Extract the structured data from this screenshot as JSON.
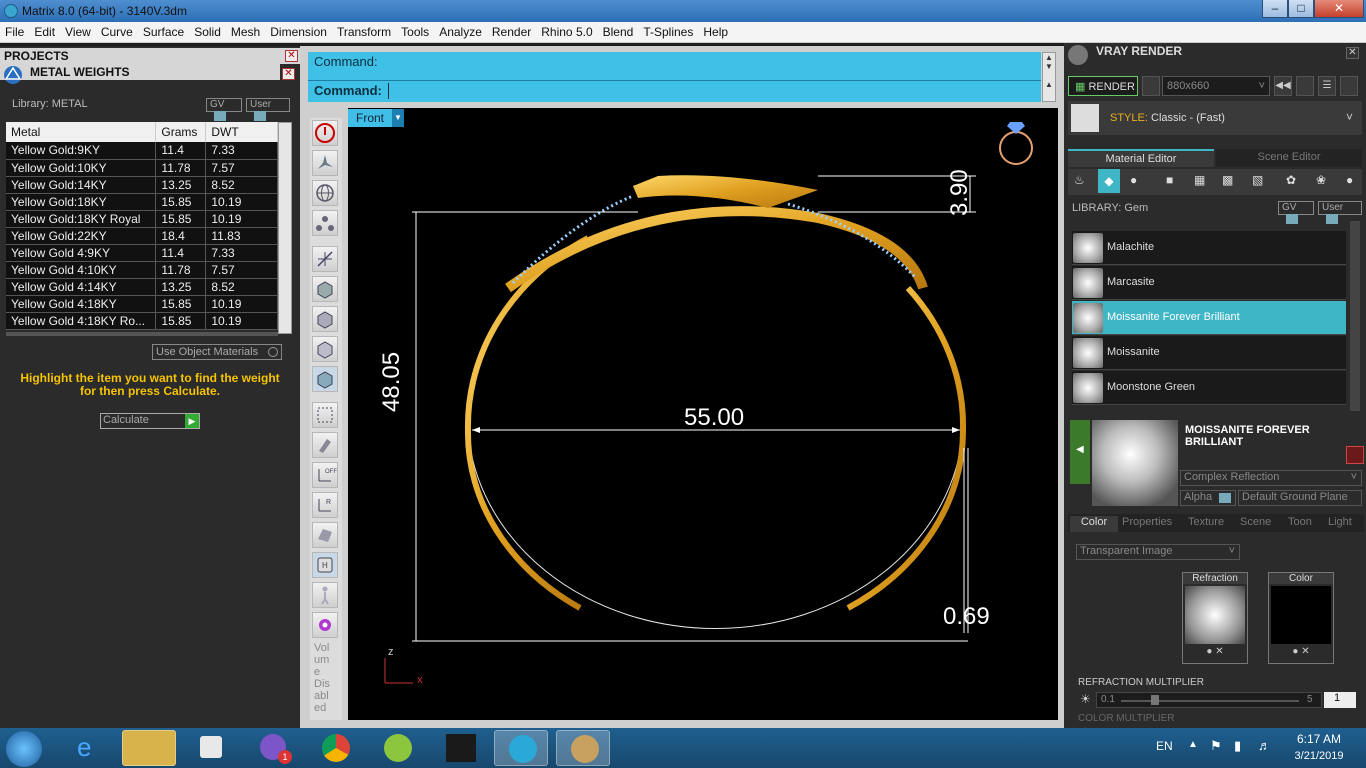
{
  "window": {
    "title": "Matrix 8.0 (64-bit) - 3140V.3dm"
  },
  "menu": [
    "File",
    "Edit",
    "View",
    "Curve",
    "Surface",
    "Solid",
    "Mesh",
    "Dimension",
    "Transform",
    "Tools",
    "Analyze",
    "Render",
    "Rhino 5.0",
    "Blend",
    "T-Splines",
    "Help"
  ],
  "left": {
    "projects_title": "PROJECTS",
    "panel_title": "METAL WEIGHTS",
    "library": "Library: METAL",
    "gv": "GV",
    "user": "User",
    "columns": [
      "Metal",
      "Grams",
      "DWT"
    ],
    "rows": [
      [
        "Yellow Gold:9KY",
        "11.4",
        "7.33"
      ],
      [
        "Yellow Gold:10KY",
        "11.78",
        "7.57"
      ],
      [
        "Yellow Gold:14KY",
        "13.25",
        "8.52"
      ],
      [
        "Yellow Gold:18KY",
        "15.85",
        "10.19"
      ],
      [
        "Yellow Gold:18KY Royal",
        "15.85",
        "10.19"
      ],
      [
        "Yellow Gold:22KY",
        "18.4",
        "11.83"
      ],
      [
        "Yellow Gold 4:9KY",
        "11.4",
        "7.33"
      ],
      [
        "Yellow Gold 4:10KY",
        "11.78",
        "7.57"
      ],
      [
        "Yellow Gold 4:14KY",
        "13.25",
        "8.52"
      ],
      [
        "Yellow Gold 4:18KY",
        "15.85",
        "10.19"
      ],
      [
        "Yellow Gold 4:18KY Ro...",
        "15.85",
        "10.19"
      ]
    ],
    "use_object_materials": "Use Object Materials",
    "hint": "Highlight the item you want to find the weight for then press Calculate.",
    "calculate": "Calculate"
  },
  "command": {
    "line1": "Command:",
    "line2": "Command:"
  },
  "viewport": {
    "view_name": "Front",
    "dims": {
      "width": "55.00",
      "height": "48.05",
      "top": "3.90",
      "band": "0.69"
    },
    "axis_z": "z",
    "axis_x": "x"
  },
  "toolbar_status": [
    "Vol",
    "um",
    "e",
    "Dis",
    "abl",
    "ed"
  ],
  "right": {
    "header": "VRAY RENDER",
    "render_btn": "RENDER",
    "resolution": "880x660",
    "style_label": "STYLE:",
    "style_value": "Classic - (Fast)",
    "tab_material": "Material Editor",
    "tab_scene": "Scene Editor",
    "library": "LIBRARY: Gem",
    "gv": "GV",
    "user": "User",
    "materials": [
      "Malachite",
      "Marcasite",
      "Moissanite Forever Brilliant",
      "Moissanite",
      "Moonstone Green"
    ],
    "selected_index": 2,
    "selected_name": "MOISSANITE FOREVER BRILLIANT",
    "shader": "Complex Reflection",
    "alpha": "Alpha",
    "ground": "Default Ground Plane",
    "prop_tabs": [
      "Color",
      "Properties",
      "Texture",
      "Scene",
      "Toon",
      "Light"
    ],
    "transparent": "Transparent Image",
    "refraction": "Refraction",
    "color": "Color",
    "refraction_mult": "REFRACTION MULTIPLIER",
    "mult_min": "0.1",
    "mult_max": "5",
    "mult_value": "1",
    "color_mult": "COLOR MULTIPLIER"
  },
  "taskbar": {
    "lang": "EN",
    "time": "6:17 AM",
    "date": "3/21/2019",
    "badge": "1"
  }
}
